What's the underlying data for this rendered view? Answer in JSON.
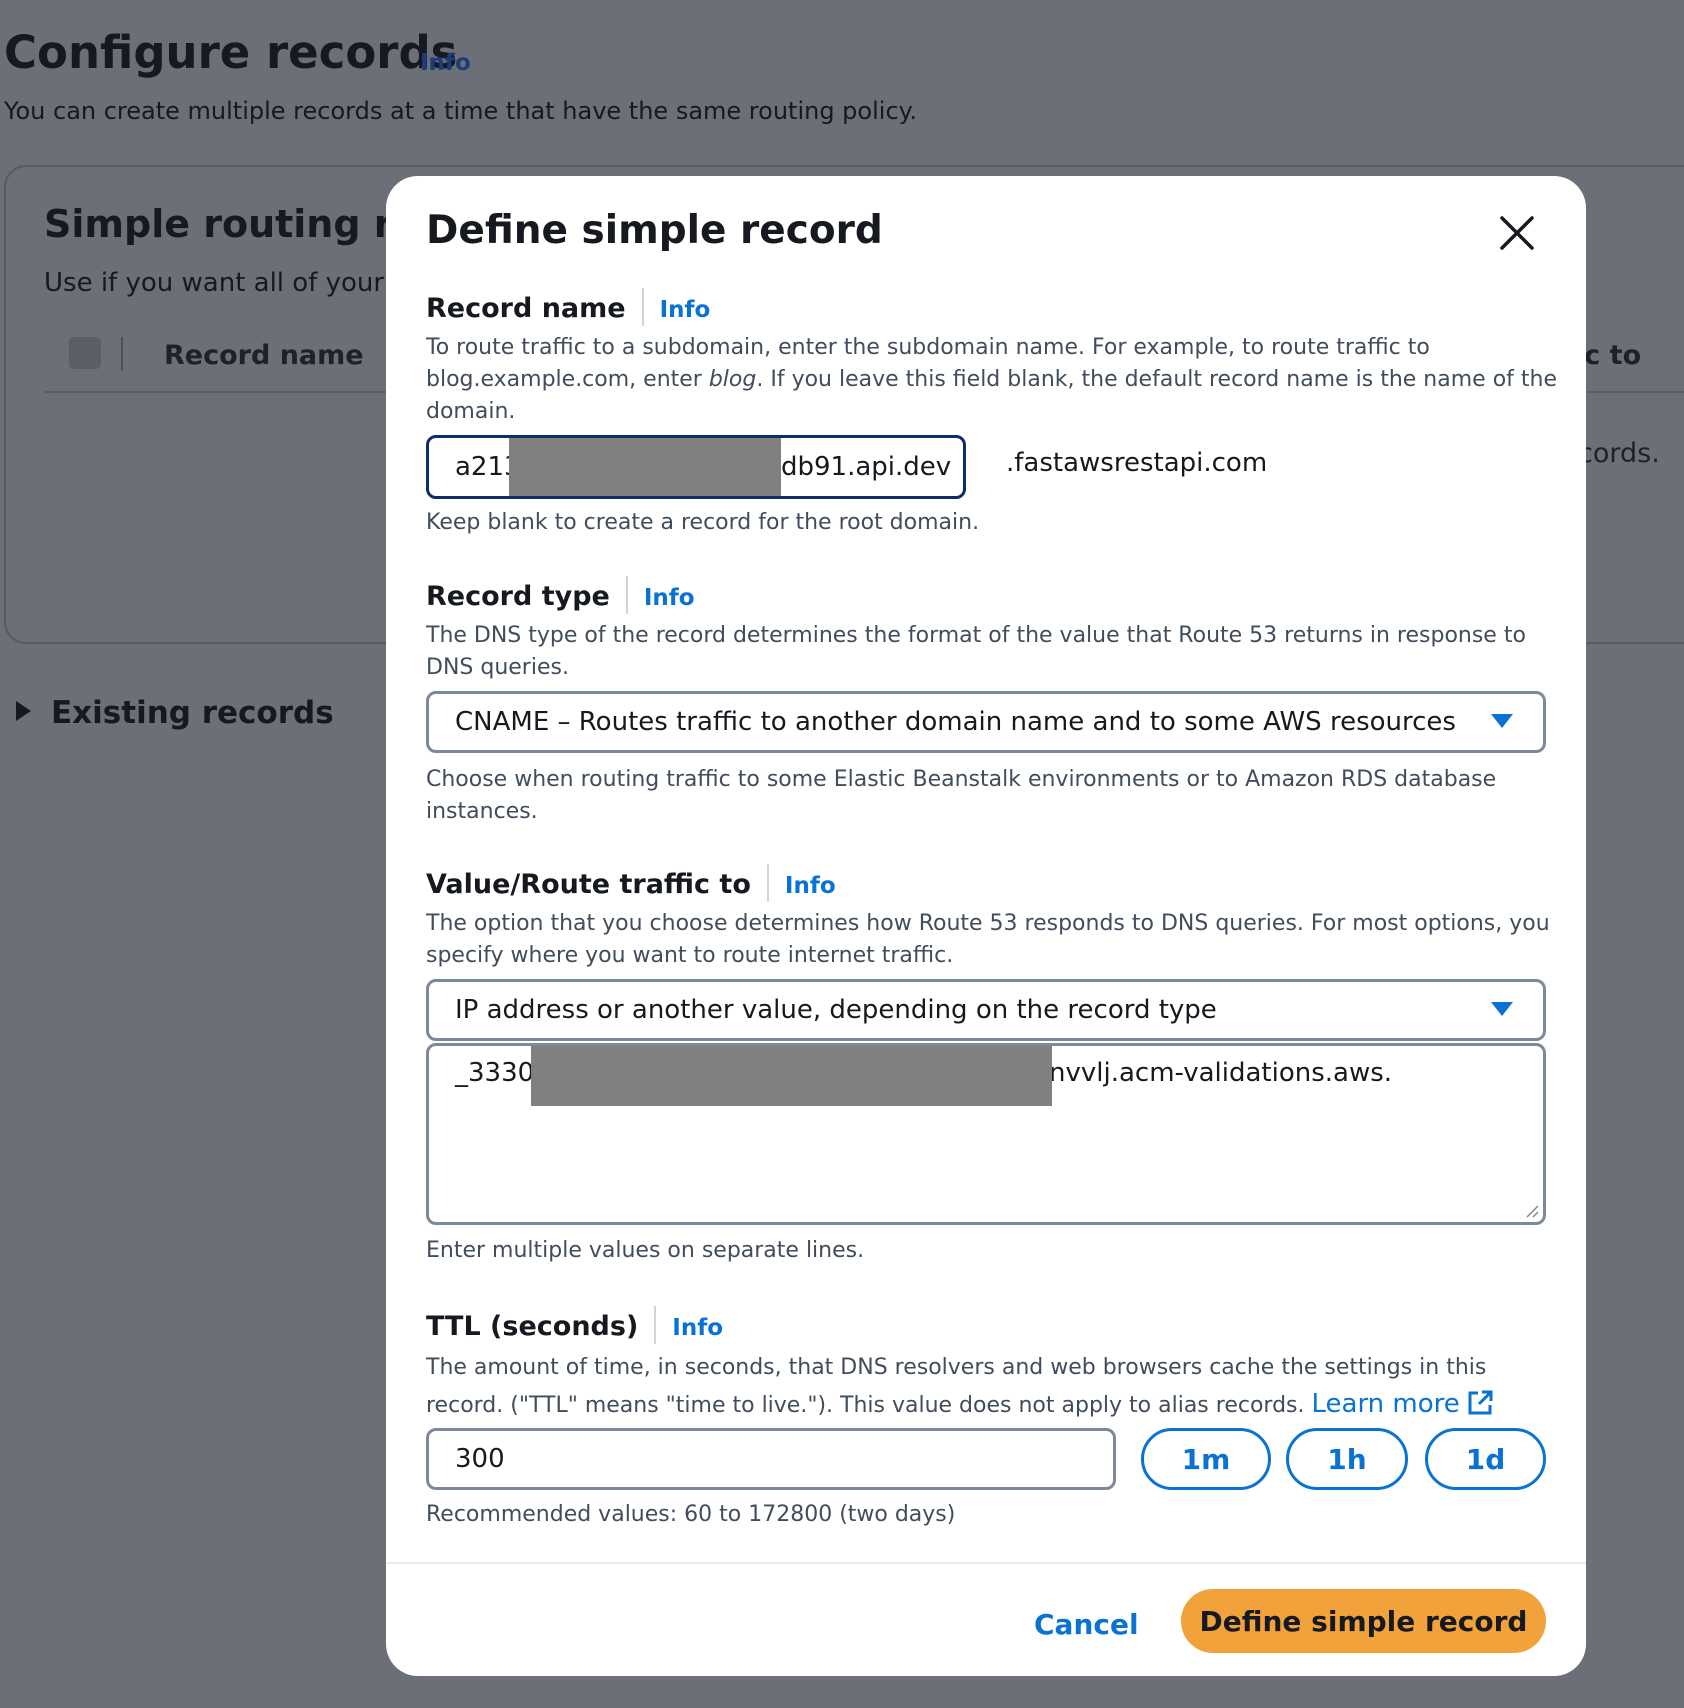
{
  "background": {
    "page_title": "Configure records",
    "page_info": "Info",
    "page_description": "You can create multiple records at a time that have the same routing policy.",
    "card_title": "Simple routing rec",
    "card_description": "Use if you want all of your",
    "table_col_record_name": "Record name",
    "table_col_right": "ic to",
    "table_right_text": "cords.",
    "existing_records": "Existing records"
  },
  "modal": {
    "title": "Define simple record",
    "close_icon": "close-icon",
    "record_name": {
      "label": "Record name",
      "info": "Info",
      "description_part1": "To route traffic to a subdomain, enter the subdomain name. For example, to route traffic to blog.example.com, enter ",
      "description_em": "blog",
      "description_part2": ". If you leave this field blank, the default record name is the name of the domain.",
      "value_start": "a213",
      "value_end": "db91.api.dev",
      "domain_suffix": ".fastawsrestapi.com",
      "hint": "Keep blank to create a record for the root domain."
    },
    "record_type": {
      "label": "Record type",
      "info": "Info",
      "description": "The DNS type of the record determines the format of the value that Route 53 returns in response to DNS queries.",
      "selected": "CNAME – Routes traffic to another domain name and to some AWS resources",
      "hint": "Choose when routing traffic to some Elastic Beanstalk environments or to Amazon RDS database instances."
    },
    "value_route": {
      "label": "Value/Route traffic to",
      "info": "Info",
      "description": "The option that you choose determines how Route 53 responds to DNS queries. For most options, you specify where you want to route internet traffic.",
      "selected": "IP address or another value, depending on the record type",
      "value_start": "_3330",
      "value_end": "nvvlj.acm-validations.aws.",
      "hint": "Enter multiple values on separate lines."
    },
    "ttl": {
      "label": "TTL (seconds)",
      "info": "Info",
      "description": "The amount of time, in seconds, that DNS resolvers and web browsers cache the settings in this record. (\"TTL\" means \"time to live.\"). This value does not apply to alias records. ",
      "learn_more": "Learn more",
      "value": "300",
      "presets": [
        "1m",
        "1h",
        "1d"
      ],
      "hint": "Recommended values: 60 to 172800 (two days)"
    },
    "cancel_label": "Cancel",
    "submit_label": "Define simple record"
  },
  "colors": {
    "accent": "#0972d3",
    "primary_button": "#f2a23a",
    "overlay": "#6b6f78"
  }
}
